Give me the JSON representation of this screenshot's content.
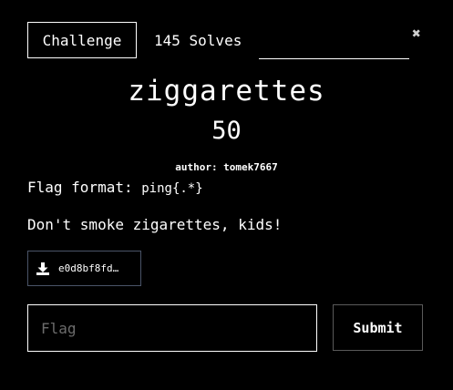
{
  "tabs": {
    "challenge_label": "Challenge",
    "solves_label": "145 Solves"
  },
  "close_icon": "close-icon",
  "challenge": {
    "name": "ziggarettes",
    "points": "50",
    "author": "author: tomek7667",
    "description": {
      "flag_format_label": "Flag format: ",
      "flag_format_code": "ping{.*}",
      "text": "Don't smoke zigarettes, kids!"
    },
    "file": {
      "icon": "download-icon",
      "name": "e0d8bf8fd…"
    }
  },
  "form": {
    "flag_placeholder": "Flag",
    "submit_label": "Submit"
  },
  "colors": {
    "background": "#000000",
    "text": "#ffffff",
    "file_border": "#4a5468"
  }
}
